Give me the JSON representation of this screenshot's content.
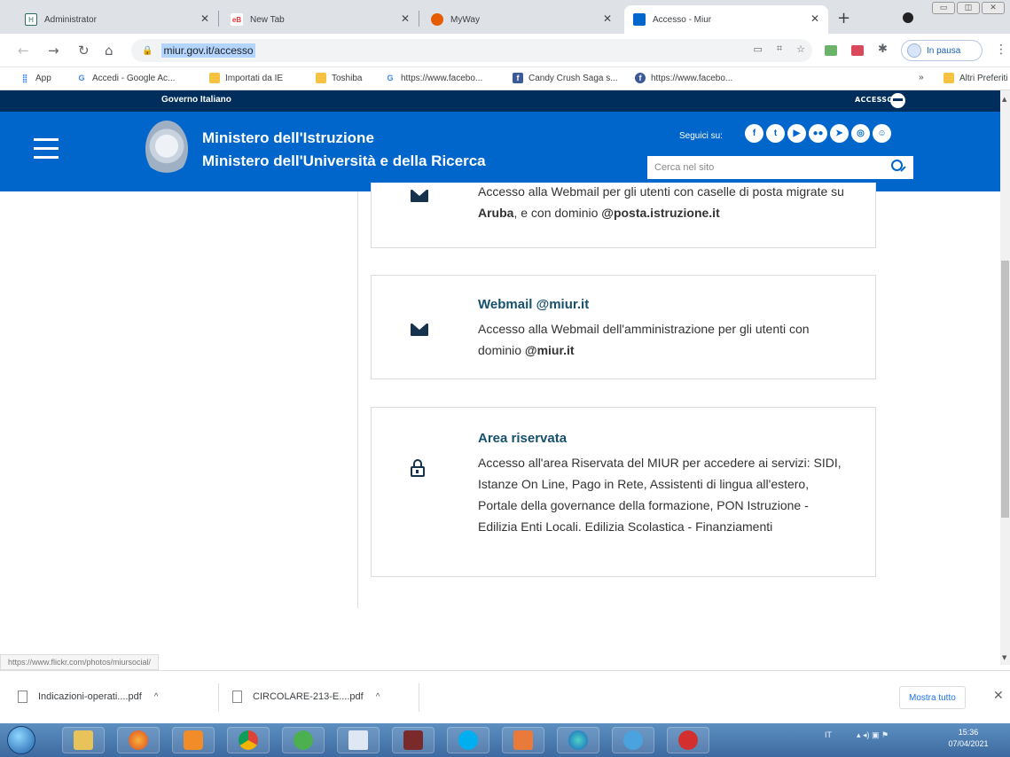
{
  "browser": {
    "tabs": [
      {
        "title": "Administrator",
        "favicon": "H"
      },
      {
        "title": "New Tab",
        "favicon": "eB"
      },
      {
        "title": "MyWay",
        "favicon": ""
      },
      {
        "title": "Accesso - Miur",
        "favicon": ""
      }
    ],
    "address": {
      "url": "miur.gov.it/accesso"
    },
    "profile_status": "In pausa",
    "bookmarks": [
      {
        "label": "App",
        "icon": "apps-grid-icon"
      },
      {
        "label": "Accedi - Google Ac...",
        "icon": "G"
      },
      {
        "label": "Importati da IE",
        "icon": "folder-icon"
      },
      {
        "label": "Toshiba",
        "icon": "folder-icon"
      },
      {
        "label": "https://www.facebo...",
        "icon": "G"
      },
      {
        "label": "Candy Crush Saga s...",
        "icon": "facebook-icon"
      },
      {
        "label": "https://www.facebo...",
        "icon": "facebook-icon"
      }
    ],
    "bookmarks_more": "»",
    "bookmarks_other": "Altri Preferiti"
  },
  "site": {
    "gov_bar_title": "Governo Italiano",
    "login_label": "ACCESSO",
    "ministry_line1": "Ministero dell'Istruzione",
    "ministry_line2": "Ministero dell'Università e della Ricerca",
    "follow_label": "Seguici su:",
    "social": [
      "f",
      "t",
      "yt",
      "fl",
      "tg",
      "ig",
      "gh"
    ],
    "search_placeholder": "Cerca nel sito"
  },
  "cards": [
    {
      "title": "",
      "desc_parts": [
        "Accesso alla Webmail per gli utenti con caselle di posta migrate su ",
        "Aruba",
        ", e con dominio ",
        "@posta.istruzione.it"
      ]
    },
    {
      "title": "Webmail @miur.it",
      "desc_parts": [
        "Accesso alla Webmail dell'amministrazione per gli utenti con dominio ",
        "@miur.it"
      ]
    },
    {
      "title": "Area riservata",
      "desc": "Accesso all'area Riservata del MIUR per accedere ai servizi: SIDI, Istanze On Line, Pago in Rete, Assistenti di lingua all'estero, Portale della governance della formazione, PON Istruzione - Edilizia Enti Locali. Edilizia Scolastica - Finanziamenti"
    }
  ],
  "status_url": "https://www.flickr.com/photos/miursocial/",
  "downloads": [
    {
      "name": "Indicazioni-operati....pdf"
    },
    {
      "name": "CIRCOLARE-213-E....pdf"
    }
  ],
  "show_all_label": "Mostra tutto",
  "taskbar": {
    "tray_lang": "IT",
    "time": "15:36",
    "date": "07/04/2021"
  },
  "colors": {
    "gov_bar": "#002e5c",
    "header": "#0066cc",
    "card_title": "#17506e"
  }
}
